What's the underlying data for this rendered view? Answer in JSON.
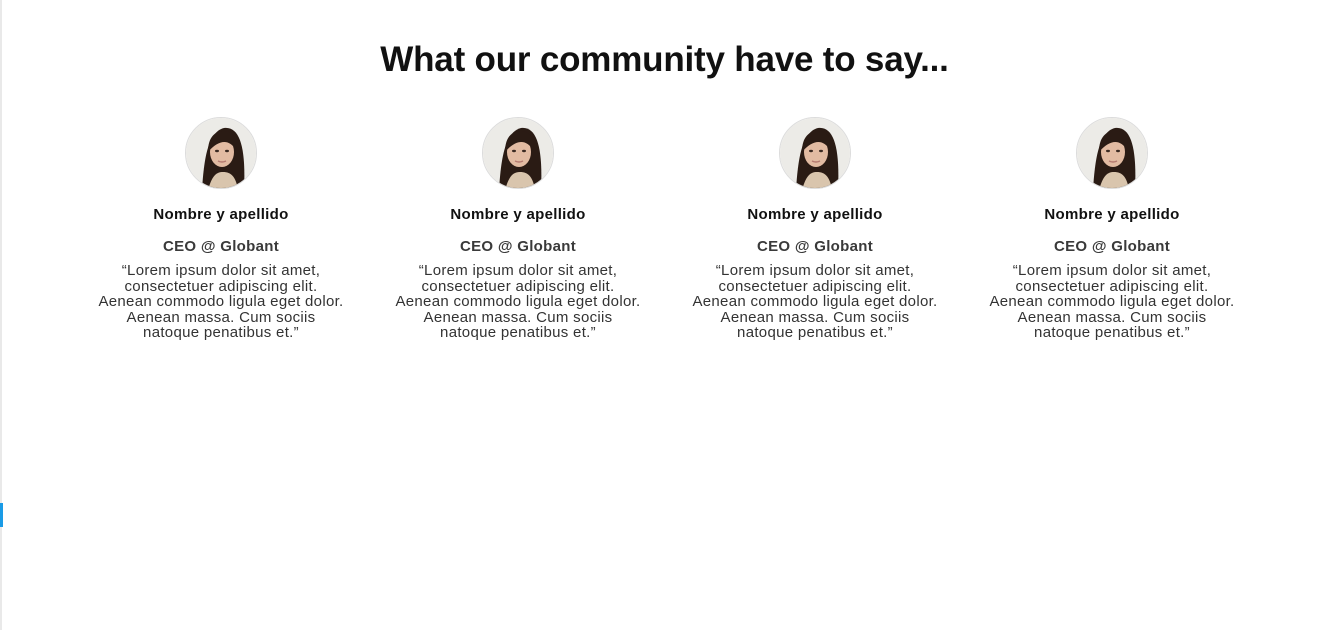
{
  "section": {
    "title": "What our community have to say..."
  },
  "testimonials": [
    {
      "name": "Nombre y apellido",
      "role": "CEO @ Globant",
      "quote": "“Lorem ipsum dolor sit amet, consectetuer adipiscing elit. Aenean commodo ligula eget dolor. Aenean massa. Cum sociis natoque penatibus et.”"
    },
    {
      "name": "Nombre y apellido",
      "role": "CEO @ Globant",
      "quote": "“Lorem ipsum dolor sit amet, consectetuer adipiscing elit. Aenean commodo ligula eget dolor. Aenean massa. Cum sociis natoque penatibus et.”"
    },
    {
      "name": "Nombre y apellido",
      "role": "CEO @ Globant",
      "quote": "“Lorem ipsum dolor sit amet, consectetuer adipiscing elit. Aenean commodo ligula eget dolor. Aenean massa. Cum sociis natoque penatibus et.”"
    },
    {
      "name": "Nombre y apellido",
      "role": "CEO @ Globant",
      "quote": "“Lorem ipsum dolor sit amet, consectetuer adipiscing elit. Aenean commodo ligula eget dolor. Aenean massa. Cum sociis natoque penatibus et.”"
    }
  ],
  "colors": {
    "scroll_indicator": "#1a9be6",
    "title_text": "#111111",
    "body_text": "#333333"
  }
}
